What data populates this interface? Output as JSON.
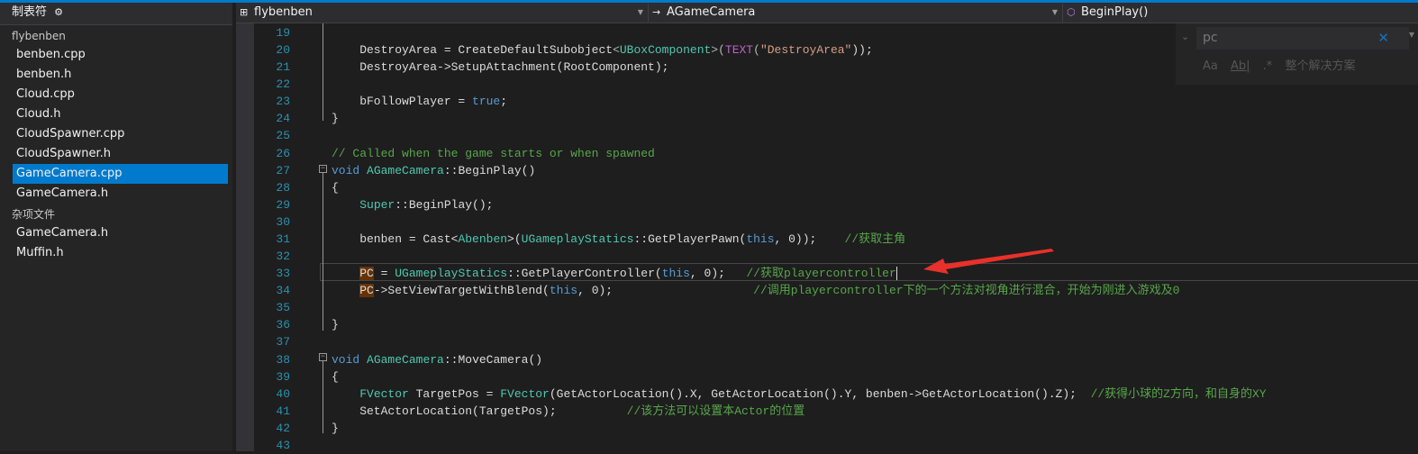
{
  "sidebar": {
    "title": "制表符",
    "gear_icon": "⚙",
    "groups": [
      {
        "label": "flybenben",
        "items": [
          "benben.cpp",
          "benben.h",
          "Cloud.cpp",
          "Cloud.h",
          "CloudSpawner.cpp",
          "CloudSpawner.h",
          "GameCamera.cpp",
          "GameCamera.h"
        ]
      },
      {
        "label": "杂项文件",
        "items": [
          "GameCamera.h",
          "Muffin.h"
        ]
      }
    ],
    "selected": "GameCamera.cpp"
  },
  "navbar": {
    "project": "flybenben",
    "scope": "AGameCamera",
    "member": "BeginPlay()"
  },
  "find": {
    "value": "pc",
    "opt_case": "Aa",
    "opt_word": "Ab|",
    "opt_regex": ".*",
    "scope": "整个解决方案"
  },
  "editor": {
    "current_line": 33,
    "lines": [
      {
        "n": "19",
        "t": []
      },
      {
        "n": "20",
        "t": [
          [
            "    DestroyArea = CreateDefaultSubobject",
            ""
          ],
          [
            "<",
            "p"
          ],
          [
            "UBoxComponent",
            "t"
          ],
          [
            ">(",
            "p"
          ],
          [
            "TEXT",
            "m"
          ],
          [
            "(",
            "p"
          ],
          [
            "\"DestroyArea\"",
            "s"
          ],
          [
            "));",
            ""
          ]
        ]
      },
      {
        "n": "21",
        "t": [
          [
            "    DestroyArea->SetupAttachment(RootComponent);",
            ""
          ]
        ]
      },
      {
        "n": "22",
        "t": []
      },
      {
        "n": "23",
        "t": [
          [
            "    bFollowPlayer = ",
            ""
          ],
          [
            "true",
            "k"
          ],
          [
            ";",
            ""
          ]
        ]
      },
      {
        "n": "24",
        "t": [
          [
            "}",
            ""
          ]
        ]
      },
      {
        "n": "25",
        "t": []
      },
      {
        "n": "26",
        "t": [
          [
            "// Called when the game starts or when spawned",
            "c"
          ]
        ]
      },
      {
        "n": "27",
        "t": [
          [
            "void",
            "k"
          ],
          [
            " ",
            ""
          ],
          [
            "AGameCamera",
            "t"
          ],
          [
            "::BeginPlay()",
            ""
          ]
        ]
      },
      {
        "n": "28",
        "t": [
          [
            "{",
            ""
          ]
        ]
      },
      {
        "n": "29",
        "t": [
          [
            "    ",
            ""
          ],
          [
            "Super",
            "t"
          ],
          [
            "::BeginPlay();",
            ""
          ]
        ]
      },
      {
        "n": "30",
        "t": []
      },
      {
        "n": "31",
        "t": [
          [
            "    benben = Cast<",
            ""
          ],
          [
            "Abenben",
            "t"
          ],
          [
            ">(",
            ""
          ],
          [
            "UGameplayStatics",
            "t"
          ],
          [
            "::GetPlayerPawn(",
            ""
          ],
          [
            "this",
            "k"
          ],
          [
            ", 0));    ",
            ""
          ],
          [
            "//获取主角",
            "c"
          ]
        ]
      },
      {
        "n": "32",
        "t": []
      },
      {
        "n": "33",
        "t": [
          [
            "    ",
            ""
          ],
          [
            "PC",
            "h"
          ],
          [
            " = ",
            ""
          ],
          [
            "UGameplayStatics",
            "t"
          ],
          [
            "::GetPlayerController(",
            ""
          ],
          [
            "this",
            "k"
          ],
          [
            ", 0);   ",
            ""
          ],
          [
            "//获取playercontroller",
            "c"
          ]
        ]
      },
      {
        "n": "34",
        "t": [
          [
            "    ",
            ""
          ],
          [
            "PC",
            "h"
          ],
          [
            "->SetViewTargetWithBlend(",
            ""
          ],
          [
            "this",
            "k"
          ],
          [
            ", 0);                    ",
            ""
          ],
          [
            "//调用playercontroller下的一个方法对视角进行混合，开始为刚进入游戏及0",
            "c"
          ]
        ]
      },
      {
        "n": "35",
        "t": []
      },
      {
        "n": "36",
        "t": [
          [
            "}",
            ""
          ]
        ]
      },
      {
        "n": "37",
        "t": []
      },
      {
        "n": "38",
        "t": [
          [
            "void",
            "k"
          ],
          [
            " ",
            ""
          ],
          [
            "AGameCamera",
            "t"
          ],
          [
            "::MoveCamera()",
            ""
          ]
        ]
      },
      {
        "n": "39",
        "t": [
          [
            "{",
            ""
          ]
        ]
      },
      {
        "n": "40",
        "t": [
          [
            "    ",
            ""
          ],
          [
            "FVector",
            "t"
          ],
          [
            " TargetPos = ",
            ""
          ],
          [
            "FVector",
            "t"
          ],
          [
            "(GetActorLocation().X, GetActorLocation().Y, benben->GetActorLocation().Z);  ",
            ""
          ],
          [
            "//获得小球的Z方向，和自身的XY",
            "c"
          ]
        ]
      },
      {
        "n": "41",
        "t": [
          [
            "    SetActorLocation(TargetPos);          ",
            ""
          ],
          [
            "//该方法可以设置本Actor的位置",
            "c"
          ]
        ]
      },
      {
        "n": "42",
        "t": [
          [
            "}",
            ""
          ]
        ]
      },
      {
        "n": "43",
        "t": []
      }
    ]
  },
  "colors": {
    "accent": "#007acc",
    "comment": "#57a64a",
    "keyword": "#569cd6",
    "type": "#4ec9b0",
    "arrow": "#e8312a"
  }
}
